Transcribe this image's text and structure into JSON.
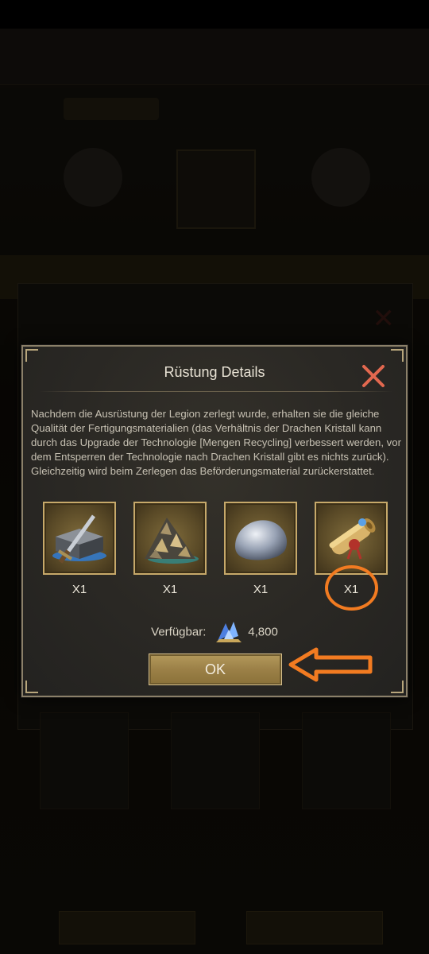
{
  "dialog": {
    "title": "Rüstung Details",
    "description": "Nachdem die Ausrüstung der Legion zerlegt wurde, erhalten sie die gleiche Qualität der Fertigungsmaterialien (das Verhältnis der Drachen Kristall kann durch das Upgrade der Technologie [Mengen Recycling] verbessert werden, vor dem Entsperren der Technologie nach Drachen Kristall gibt es nichts zurück). Gleichzeitig wird beim Zerlegen das Beförderungsmaterial zurückerstattet.",
    "items": [
      {
        "icon": "iron-ingot-sword-icon",
        "quantity": "X1"
      },
      {
        "icon": "ore-pile-icon",
        "quantity": "X1"
      },
      {
        "icon": "silver-stone-icon",
        "quantity": "X1"
      },
      {
        "icon": "scroll-icon",
        "quantity": "X1"
      }
    ],
    "available_label": "Verfügbar:",
    "available_icon": "drachen-kristall-icon",
    "available_value": "4,800",
    "ok_label": "OK"
  },
  "colors": {
    "accent": "#f27b21",
    "button_gold": "#9b8047",
    "close_red": "#e2684f"
  }
}
